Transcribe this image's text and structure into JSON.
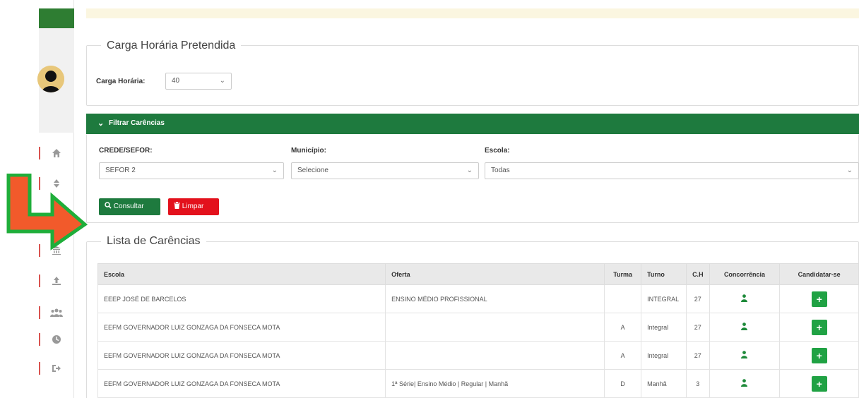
{
  "carga": {
    "legend": "Carga Horária Pretendida",
    "label": "Carga Horária:",
    "value": "40"
  },
  "filter": {
    "title": "Filtrar Carências",
    "crede_label": "CREDE/SEFOR:",
    "crede_value": "SEFOR 2",
    "municipio_label": "Município:",
    "municipio_value": "Selecione",
    "escola_label": "Escola:",
    "escola_value": "Todas",
    "consultar_label": "Consultar",
    "limpar_label": "Limpar"
  },
  "lista": {
    "legend": "Lista de Carências",
    "headers": {
      "escola": "Escola",
      "oferta": "Oferta",
      "turma": "Turma",
      "turno": "Turno",
      "ch": "C.H",
      "concorrencia": "Concorrência",
      "candidatar": "Candidatar-se"
    },
    "rows": [
      {
        "escola": "EEEP JOSÉ DE BARCELOS",
        "oferta": "ENSINO MÉDIO PROFISSIONAL",
        "turma": "",
        "turno": "INTEGRAL",
        "ch": "27"
      },
      {
        "escola": "EEFM GOVERNADOR LUIZ GONZAGA DA FONSECA MOTA",
        "oferta": "",
        "turma": "A",
        "turno": "Integral",
        "ch": "27"
      },
      {
        "escola": "EEFM GOVERNADOR LUIZ GONZAGA DA FONSECA MOTA",
        "oferta": "",
        "turma": "A",
        "turno": "Integral",
        "ch": "27"
      },
      {
        "escola": "EEFM GOVERNADOR LUIZ GONZAGA DA FONSECA MOTA",
        "oferta": "1ª Série| Ensino Médio | Regular | Manhã",
        "turma": "D",
        "turno": "Manhã",
        "ch": "3"
      }
    ]
  },
  "colors": {
    "primary_green": "#1e7a3e",
    "danger_red": "#e3111c",
    "annotation_arrow_fill": "#f25a2b",
    "annotation_arrow_stroke": "#1fae3a"
  },
  "icons": {
    "sidebar": [
      "home-icon",
      "sort-icon",
      "bank-icon",
      "upload-icon",
      "users-icon",
      "clock-icon",
      "sign-out-icon"
    ],
    "concorrencia": "person-icon",
    "candidatar": "plus-square-icon"
  }
}
